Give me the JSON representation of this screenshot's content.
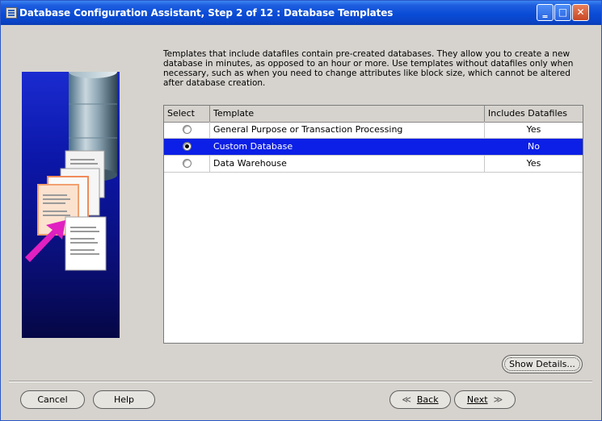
{
  "window": {
    "title": "Database Configuration Assistant, Step 2 of 12 : Database Templates",
    "controls": {
      "minimize": "_",
      "maximize": "□",
      "close": "✕"
    }
  },
  "intro": "Templates that include datafiles contain pre-created databases. They allow you to create a new database in minutes, as opposed to an hour or more. Use templates without datafiles only when necessary, such as when you need to change attributes like block size, which cannot be altered after database creation.",
  "table": {
    "headers": [
      "Select",
      "Template",
      "Includes Datafiles"
    ],
    "rows": [
      {
        "template": "General Purpose or Transaction Processing",
        "datafiles": "Yes",
        "selected": false
      },
      {
        "template": "Custom Database",
        "datafiles": "No",
        "selected": true
      },
      {
        "template": "Data Warehouse",
        "datafiles": "Yes",
        "selected": false
      }
    ]
  },
  "buttons": {
    "show_details": "Show Details...",
    "cancel": "Cancel",
    "help": "Help",
    "back_arrow": "≪",
    "back": "Back",
    "next": "Next",
    "next_arrow": "≫"
  },
  "icons": [
    "database-cylinder-icon",
    "document-stack-icon",
    "pink-arrow-icon"
  ],
  "colors": {
    "title_bar": "#0a4cd6",
    "selection": "#0b1fe6",
    "side_panel": "#0b16a6",
    "arrow": "#e020c0"
  }
}
